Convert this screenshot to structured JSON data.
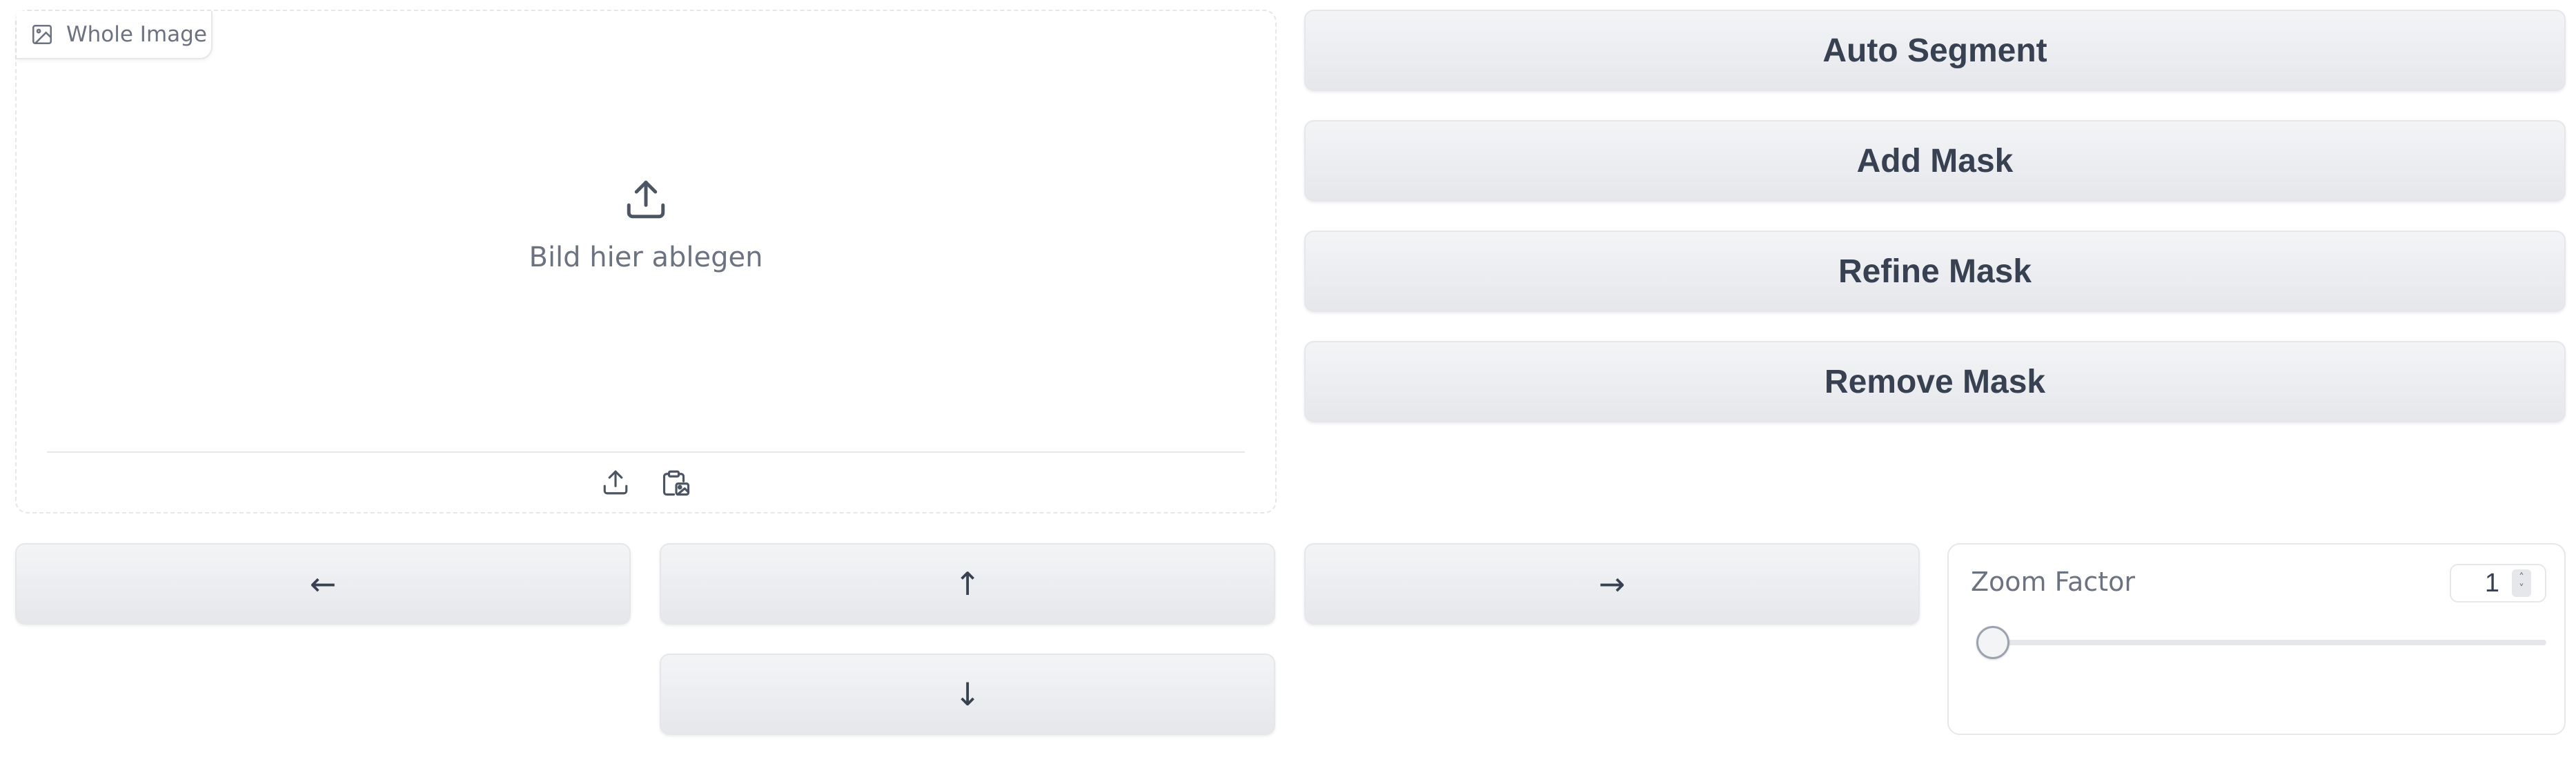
{
  "image_input": {
    "label": "Whole Image",
    "drop_text": "Bild hier ablegen",
    "label_icon": "image-icon",
    "upload_icon": "upload-icon",
    "sources": [
      "upload-icon",
      "clipboard-icon"
    ]
  },
  "actions": {
    "auto_segment": "Auto Segment",
    "add_mask": "Add Mask",
    "refine_mask": "Refine Mask",
    "remove_mask": "Remove Mask"
  },
  "navigation": {
    "left": "←",
    "up": "↑",
    "right": "→",
    "down": "↓"
  },
  "zoom": {
    "label": "Zoom Factor",
    "value": "1",
    "slider_fraction": 0.0
  },
  "colors": {
    "button_bg": "#e5e7eb",
    "border": "#e5e7eb",
    "text": "#374151",
    "muted_text": "#6b7280"
  }
}
